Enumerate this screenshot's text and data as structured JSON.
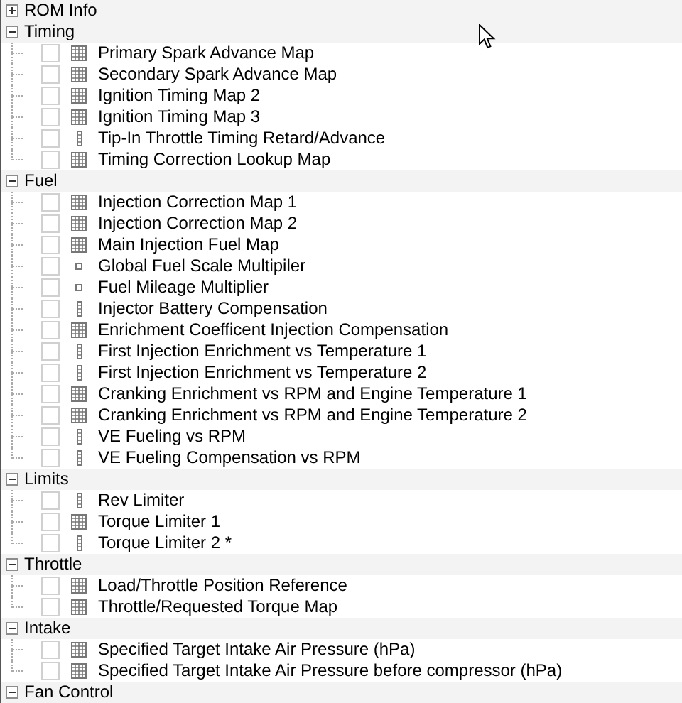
{
  "categories": [
    {
      "label": "ROM Info",
      "expanded": false
    },
    {
      "label": "Timing",
      "expanded": true,
      "children": [
        {
          "label": "Primary Spark Advance Map",
          "kind": "table3d",
          "checked": false
        },
        {
          "label": "Secondary Spark Advance Map",
          "kind": "table3d",
          "checked": false
        },
        {
          "label": "Ignition Timing Map 2",
          "kind": "table3d",
          "checked": false
        },
        {
          "label": "Ignition Timing Map 3",
          "kind": "table3d",
          "checked": false
        },
        {
          "label": "Tip-In Throttle Timing Retard/Advance",
          "kind": "table2d",
          "checked": false
        },
        {
          "label": "Timing Correction Lookup Map",
          "kind": "table3d",
          "checked": false
        }
      ]
    },
    {
      "label": "Fuel",
      "expanded": true,
      "children": [
        {
          "label": "Injection Correction Map 1",
          "kind": "table3d",
          "checked": false
        },
        {
          "label": "Injection Correction Map 2",
          "kind": "table3d",
          "checked": false
        },
        {
          "label": "Main Injection Fuel Map",
          "kind": "table3d",
          "checked": false
        },
        {
          "label": "Global Fuel Scale Multipiler",
          "kind": "scalar",
          "checked": false
        },
        {
          "label": "Fuel Mileage Multiplier",
          "kind": "scalar",
          "checked": false
        },
        {
          "label": "Injector Battery Compensation",
          "kind": "table2d",
          "checked": false
        },
        {
          "label": "Enrichment Coefficent Injection Compensation",
          "kind": "table3d",
          "checked": false
        },
        {
          "label": "First Injection Enrichment vs Temperature 1",
          "kind": "table2d",
          "checked": false
        },
        {
          "label": "First Injection Enrichment vs Temperature 2",
          "kind": "table2d",
          "checked": false
        },
        {
          "label": "Cranking Enrichment vs RPM and Engine Temperature 1",
          "kind": "table3d",
          "checked": false
        },
        {
          "label": "Cranking Enrichment vs RPM and Engine Temperature 2",
          "kind": "table3d",
          "checked": false
        },
        {
          "label": "VE Fueling vs RPM",
          "kind": "table2d",
          "checked": false
        },
        {
          "label": "VE Fueling Compensation vs RPM",
          "kind": "table2d",
          "checked": false
        }
      ]
    },
    {
      "label": "Limits",
      "expanded": true,
      "children": [
        {
          "label": "Rev Limiter",
          "kind": "table2d",
          "checked": false
        },
        {
          "label": "Torque Limiter 1",
          "kind": "table3d",
          "checked": false
        },
        {
          "label": "Torque Limiter 2 *",
          "kind": "table2d",
          "checked": false
        }
      ]
    },
    {
      "label": "Throttle",
      "expanded": true,
      "children": [
        {
          "label": "Load/Throttle Position Reference",
          "kind": "table3d",
          "checked": false
        },
        {
          "label": "Throttle/Requested Torque Map",
          "kind": "table3d",
          "checked": false
        }
      ]
    },
    {
      "label": "Intake",
      "expanded": true,
      "children": [
        {
          "label": "Specified Target Intake Air Pressure (hPa)",
          "kind": "table3d",
          "checked": false
        },
        {
          "label": "Specified Target Intake Air Pressure before compressor (hPa)",
          "kind": "table3d",
          "checked": false
        }
      ]
    },
    {
      "label": "Fan Control",
      "expanded": true
    }
  ]
}
